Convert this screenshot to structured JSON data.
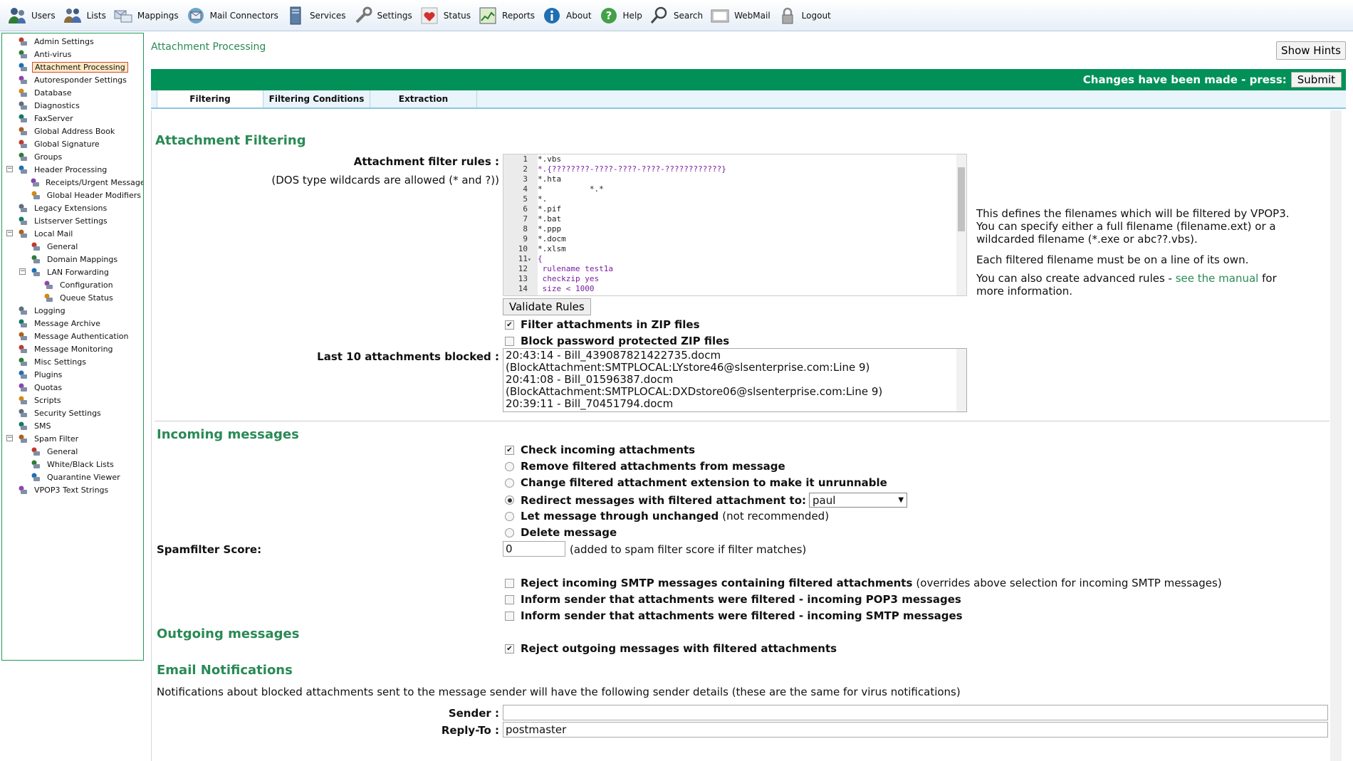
{
  "toolbar": {
    "items": [
      {
        "label": "Users",
        "icon": "users-icon"
      },
      {
        "label": "Lists",
        "icon": "lists-icon"
      },
      {
        "label": "Mappings",
        "icon": "mappings-icon"
      },
      {
        "label": "Mail Connectors",
        "icon": "mail-connectors-icon"
      },
      {
        "label": "Services",
        "icon": "services-icon"
      },
      {
        "label": "Settings",
        "icon": "settings-icon"
      },
      {
        "label": "Status",
        "icon": "status-heart-icon"
      },
      {
        "label": "Reports",
        "icon": "reports-icon"
      },
      {
        "label": "About",
        "icon": "about-info-icon"
      },
      {
        "label": "Help",
        "icon": "help-question-icon"
      },
      {
        "label": "Search",
        "icon": "search-icon"
      },
      {
        "label": "WebMail",
        "icon": "webmail-icon"
      },
      {
        "label": "Logout",
        "icon": "logout-lock-icon"
      }
    ]
  },
  "sidebar": {
    "items": [
      {
        "label": "Admin Settings",
        "level": 0,
        "selected": false
      },
      {
        "label": "Anti-virus",
        "level": 0,
        "selected": false
      },
      {
        "label": "Attachment Processing",
        "level": 0,
        "selected": true
      },
      {
        "label": "Autoresponder Settings",
        "level": 0,
        "selected": false
      },
      {
        "label": "Database",
        "level": 0,
        "selected": false
      },
      {
        "label": "Diagnostics",
        "level": 0,
        "selected": false
      },
      {
        "label": "FaxServer",
        "level": 0,
        "selected": false
      },
      {
        "label": "Global Address Book",
        "level": 0,
        "selected": false
      },
      {
        "label": "Global Signature",
        "level": 0,
        "selected": false
      },
      {
        "label": "Groups",
        "level": 0,
        "selected": false
      },
      {
        "label": "Header Processing",
        "level": 0,
        "selected": false,
        "expander": "−"
      },
      {
        "label": "Receipts/Urgent Messages",
        "level": 1,
        "selected": false
      },
      {
        "label": "Global Header Modifiers",
        "level": 1,
        "selected": false
      },
      {
        "label": "Legacy Extensions",
        "level": 0,
        "selected": false
      },
      {
        "label": "Listserver Settings",
        "level": 0,
        "selected": false
      },
      {
        "label": "Local Mail",
        "level": 0,
        "selected": false,
        "expander": "−"
      },
      {
        "label": "General",
        "level": 1,
        "selected": false
      },
      {
        "label": "Domain Mappings",
        "level": 1,
        "selected": false
      },
      {
        "label": "LAN Forwarding",
        "level": 1,
        "selected": false,
        "expander": "−"
      },
      {
        "label": "Configuration",
        "level": 2,
        "selected": false
      },
      {
        "label": "Queue Status",
        "level": 2,
        "selected": false
      },
      {
        "label": "Logging",
        "level": 0,
        "selected": false
      },
      {
        "label": "Message Archive",
        "level": 0,
        "selected": false
      },
      {
        "label": "Message Authentication",
        "level": 0,
        "selected": false
      },
      {
        "label": "Message Monitoring",
        "level": 0,
        "selected": false
      },
      {
        "label": "Misc Settings",
        "level": 0,
        "selected": false
      },
      {
        "label": "Plugins",
        "level": 0,
        "selected": false
      },
      {
        "label": "Quotas",
        "level": 0,
        "selected": false
      },
      {
        "label": "Scripts",
        "level": 0,
        "selected": false
      },
      {
        "label": "Security Settings",
        "level": 0,
        "selected": false
      },
      {
        "label": "SMS",
        "level": 0,
        "selected": false
      },
      {
        "label": "Spam Filter",
        "level": 0,
        "selected": false,
        "expander": "−"
      },
      {
        "label": "General",
        "level": 1,
        "selected": false
      },
      {
        "label": "White/Black Lists",
        "level": 1,
        "selected": false
      },
      {
        "label": "Quarantine Viewer",
        "level": 1,
        "selected": false
      },
      {
        "label": "VPOP3 Text Strings",
        "level": 0,
        "selected": false
      }
    ]
  },
  "page": {
    "title": "Attachment Processing",
    "show_hints": "Show Hints",
    "changes_text": "Changes have been made - press:",
    "submit": "Submit",
    "tabs": [
      "Filtering",
      "Filtering Conditions",
      "Extraction"
    ],
    "active_tab": "Filtering"
  },
  "filtering": {
    "heading": "Attachment Filtering",
    "rules_label": "Attachment filter rules :",
    "rules_sub": "(DOS type wildcards are allowed (* and ?))",
    "rules_lines": [
      {
        "n": "1",
        "text": "*.vbs",
        "fold": ""
      },
      {
        "n": "2",
        "text": "*.{????????-????-????-????-????????????}",
        "fold": ""
      },
      {
        "n": "3",
        "text": "*.hta",
        "fold": ""
      },
      {
        "n": "4",
        "text": "*          *.*",
        "fold": ""
      },
      {
        "n": "5",
        "text": "*.",
        "fold": ""
      },
      {
        "n": "6",
        "text": "*.pif",
        "fold": ""
      },
      {
        "n": "7",
        "text": "*.bat",
        "fold": ""
      },
      {
        "n": "8",
        "text": "*.ppp",
        "fold": ""
      },
      {
        "n": "9",
        "text": "*.docm",
        "fold": ""
      },
      {
        "n": "10",
        "text": "*.xlsm",
        "fold": ""
      },
      {
        "n": "11",
        "text": "{",
        "fold": "▾"
      },
      {
        "n": "12",
        "text": " rulename test1a",
        "fold": ""
      },
      {
        "n": "13",
        "text": " checkzip yes",
        "fold": ""
      },
      {
        "n": "14",
        "text": " size < 1000",
        "fold": ""
      }
    ],
    "validate": "Validate Rules",
    "filter_zip": "Filter attachments in ZIP files",
    "filter_zip_checked": true,
    "block_pw_zip": "Block password protected ZIP files",
    "block_pw_zip_checked": false,
    "blocked_label": "Last 10 attachments blocked :",
    "blocked_lines": [
      "20:43:14 - Bill_439087821422735.docm",
      "(BlockAttachment:SMTPLOCAL:LYstore46@slsenterprise.com:Line 9)",
      "20:41:08 - Bill_01596387.docm",
      "(BlockAttachment:SMTPLOCAL:DXDstore06@slsenterprise.com:Line 9)",
      "20:39:11 - Bill_70451794.docm"
    ],
    "hint_p1": "This defines the filenames which will be filtered by VPOP3. You can specify either a full filename (filename.ext) or a wildcarded filename (*.exe or abc??.vbs).",
    "hint_p2": "Each filtered filename must be on a line of its own.",
    "hint_p3_pre": "You can also create advanced rules - ",
    "hint_p3_link": "see the manual",
    "hint_p3_post": " for more information."
  },
  "incoming": {
    "heading": "Incoming messages",
    "check_incoming": "Check incoming attachments",
    "check_incoming_checked": true,
    "radio_remove": "Remove filtered attachments from message",
    "radio_change": "Change filtered attachment extension to make it unrunnable",
    "radio_redirect": "Redirect messages with filtered attachment to:",
    "redirect_value": "paul",
    "radio_let": "Let message through unchanged",
    "radio_let_note": "(not recommended)",
    "radio_delete": "Delete message",
    "selected_radio": "redirect",
    "spam_label": "Spamfilter Score:",
    "spam_value": "0",
    "spam_note": "(added to spam filter score if filter matches)",
    "reject_smtp": "Reject incoming SMTP messages containing filtered attachments",
    "reject_smtp_note": "(overrides above selection for incoming SMTP messages)",
    "inform_pop3": "Inform sender that attachments were filtered - incoming POP3 messages",
    "inform_smtp": "Inform sender that attachments were filtered - incoming SMTP messages"
  },
  "outgoing": {
    "heading": "Outgoing messages",
    "reject_outgoing": "Reject outgoing messages with filtered attachments",
    "reject_outgoing_checked": true
  },
  "notifications": {
    "heading": "Email Notifications",
    "desc": "Notifications about blocked attachments sent to the message sender will have the following sender details (these are the same for virus notifications)",
    "sender_label": "Sender :",
    "sender_value": "",
    "replyto_label": "Reply-To :",
    "replyto_value": "postmaster"
  },
  "colors": {
    "accent_green": "#019158",
    "heading_green": "#2a8a55",
    "tab_bar": "#e9f4fb"
  }
}
